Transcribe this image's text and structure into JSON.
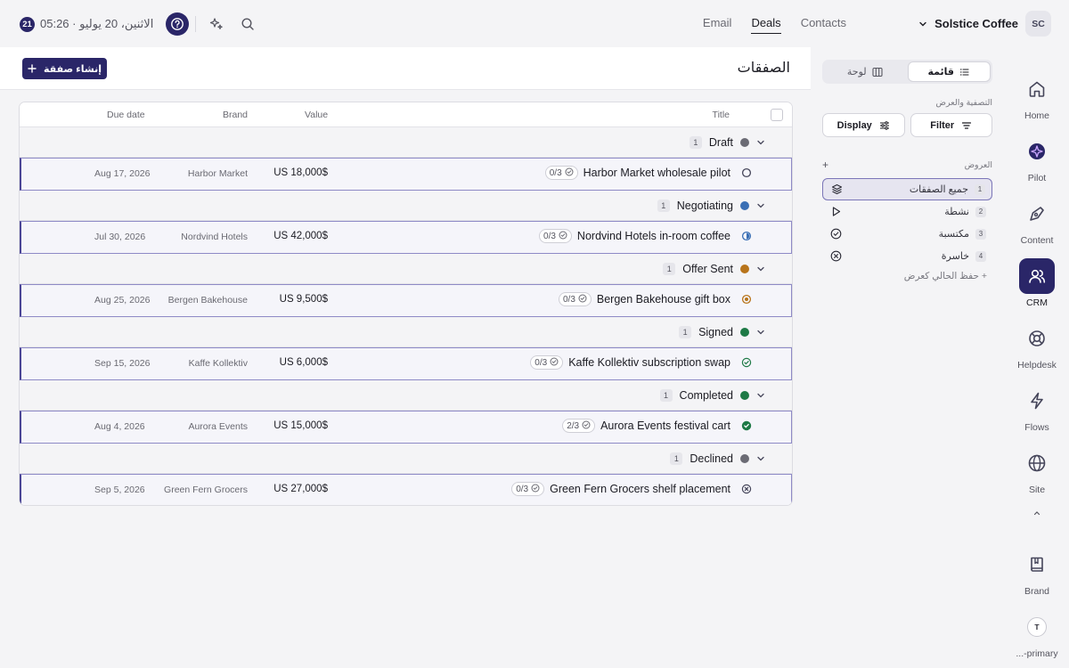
{
  "topbar": {
    "day_badge": "21",
    "datetime": "الاثنين، 20 يوليو · 05:26",
    "nav": [
      {
        "label": "Email",
        "active": false
      },
      {
        "label": "Deals",
        "active": true
      },
      {
        "label": "Contacts",
        "active": false
      }
    ],
    "org_name": "Solstice Coffee",
    "org_initials": "SC"
  },
  "rail": {
    "items": [
      {
        "label": "Home",
        "icon": "home-icon"
      },
      {
        "label": "Pilot",
        "icon": "pilot-icon"
      },
      {
        "label": "Content",
        "icon": "pen-icon"
      },
      {
        "label": "CRM",
        "icon": "users-icon",
        "active": true
      },
      {
        "label": "Helpdesk",
        "icon": "lifebuoy-icon"
      },
      {
        "label": "Flows",
        "icon": "bolt-icon"
      },
      {
        "label": "Site",
        "icon": "globe-icon"
      },
      {
        "label": "Brand",
        "icon": "book-icon"
      },
      {
        "label": "...-primary",
        "icon": "avatar-t",
        "initial": "T"
      }
    ]
  },
  "side": {
    "view_toggle": {
      "list_label": "قائمة",
      "board_label": "لوحة"
    },
    "filter_caption": "التصفية والعرض",
    "filter_label": "Filter",
    "display_label": "Display",
    "views_caption": "العروض",
    "views": [
      {
        "label": "جميع الصفقات",
        "count": "1",
        "icon": "layers-icon",
        "active": true
      },
      {
        "label": "نشطة",
        "count": "2",
        "icon": "play-icon"
      },
      {
        "label": "مكتسبة",
        "count": "3",
        "icon": "check-circle-icon"
      },
      {
        "label": "خاسرة",
        "count": "4",
        "icon": "x-circle-icon"
      }
    ],
    "save_view": "+ حفظ الحالي كعرض"
  },
  "main": {
    "title": "الصفقات",
    "create_label": "إنشاء صفقة"
  },
  "table": {
    "headers": {
      "title": "Title",
      "value": "Value",
      "brand": "Brand",
      "due": "Due date"
    },
    "groups": [
      {
        "name": "Draft",
        "count": "1",
        "color": "#6b6b74",
        "deal": {
          "title": "Harbor Market wholesale pilot",
          "subtasks": "0/3",
          "value": "$US 18,000",
          "brand": "Harbor Market",
          "due": "Aug 17, 2026",
          "status": "empty-circle-icon"
        }
      },
      {
        "name": "Negotiating",
        "count": "1",
        "color": "#3a6fb5",
        "deal": {
          "title": "Nordvind Hotels in-room coffee",
          "subtasks": "0/3",
          "value": "$US 42,000",
          "brand": "Nordvind Hotels",
          "due": "Jul 30, 2026",
          "status": "half-circle-icon"
        }
      },
      {
        "name": "Offer Sent",
        "count": "1",
        "color": "#b8741a",
        "deal": {
          "title": "Bergen Bakehouse gift box",
          "subtasks": "0/3",
          "value": "$US 9,500",
          "brand": "Bergen Bakehouse",
          "due": "Aug 25, 2026",
          "status": "dot-circle-icon"
        }
      },
      {
        "name": "Signed",
        "count": "1",
        "color": "#1e7a46",
        "deal": {
          "title": "Kaffe Kollektiv subscription swap",
          "subtasks": "0/3",
          "value": "$US 6,000",
          "brand": "Kaffe Kollektiv",
          "due": "Sep 15, 2026",
          "status": "check-outline-icon"
        }
      },
      {
        "name": "Completed",
        "count": "1",
        "color": "#1e7a46",
        "deal": {
          "title": "Aurora Events festival cart",
          "subtasks": "2/3",
          "value": "$US 15,000",
          "brand": "Aurora Events",
          "due": "Aug 4, 2026",
          "status": "check-filled-icon"
        }
      },
      {
        "name": "Declined",
        "count": "1",
        "color": "#6b6b74",
        "deal": {
          "title": "Green Fern Grocers shelf placement",
          "subtasks": "0/3",
          "value": "$US 27,000",
          "brand": "Green Fern Grocers",
          "due": "Sep 5, 2026",
          "status": "x-circle-icon"
        }
      }
    ]
  }
}
